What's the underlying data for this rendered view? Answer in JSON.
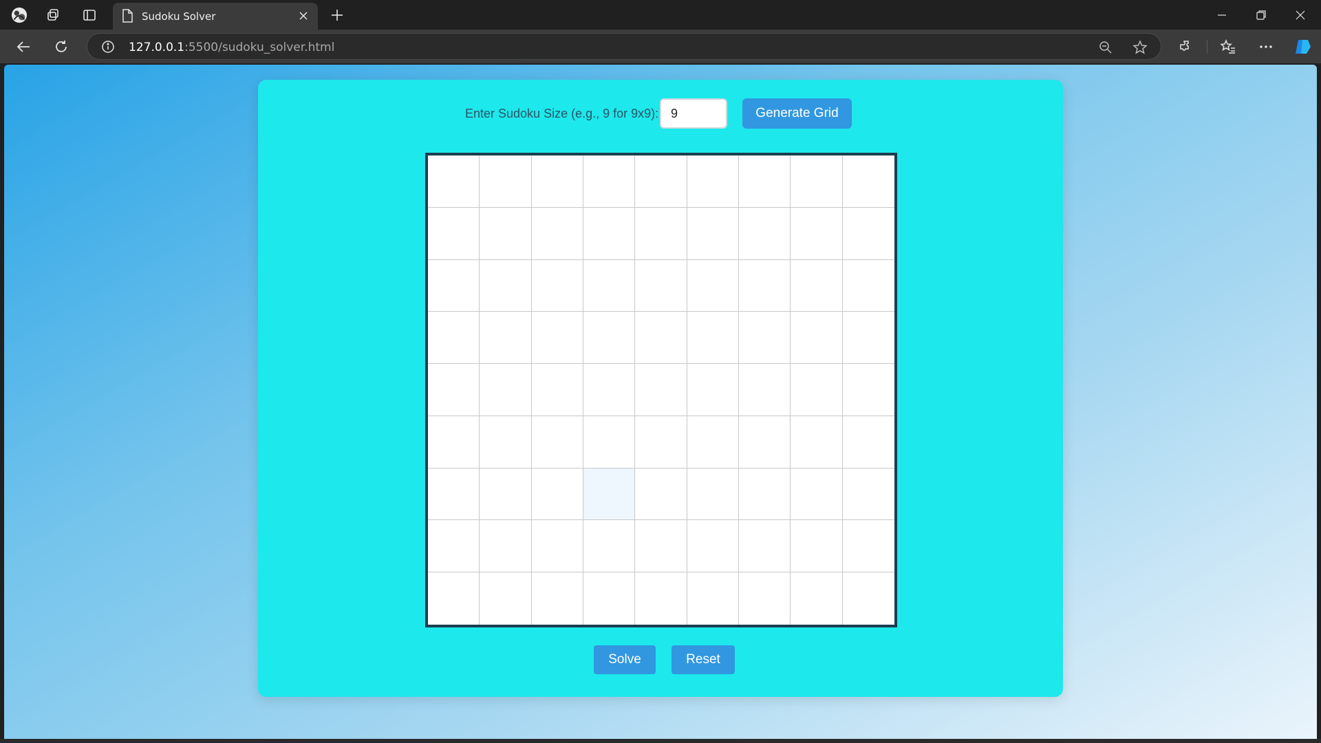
{
  "browser": {
    "tab_title": "Sudoku Solver",
    "url_host": "127.0.0.1",
    "url_path": ":5500/sudoku_solver.html"
  },
  "page": {
    "size_label": "Enter Sudoku Size (e.g., 9 for 9x9):",
    "size_value": "9",
    "generate_label": "Generate Grid",
    "solve_label": "Solve",
    "reset_label": "Reset"
  },
  "grid": {
    "size": 9,
    "focused_cell": {
      "row": 7,
      "col": 4
    }
  },
  "colors": {
    "card": "#1de8ec",
    "button": "#3197e0",
    "grid_border": "#1c3d4f",
    "focused_cell": "#eef6fe"
  }
}
